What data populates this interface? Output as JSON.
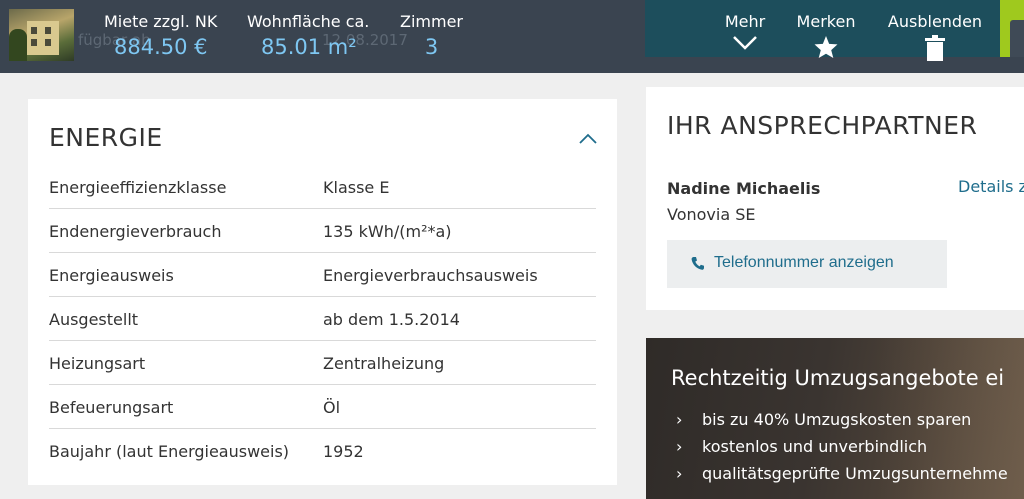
{
  "topbar": {
    "ghost_left": "fügbar ab",
    "ghost_date": "12.08.2017",
    "stats": [
      {
        "label": "Miete zzgl. NK",
        "value": "884.50 €"
      },
      {
        "label": "Wohnfläche ca.",
        "value": "85.01 m²"
      },
      {
        "label": "Zimmer",
        "value": "3"
      }
    ],
    "actions": [
      {
        "label": "Mehr",
        "icon": "chevron-down-icon"
      },
      {
        "label": "Merken",
        "icon": "star-icon"
      },
      {
        "label": "Ausblenden",
        "icon": "trash-icon"
      }
    ]
  },
  "energy": {
    "title": "ENERGIE",
    "rows": [
      {
        "key": "Energieeffizienzklasse",
        "value": "Klasse E"
      },
      {
        "key": "Endenergieverbrauch",
        "value": "135 kWh/(m²*a)"
      },
      {
        "key": "Energieausweis",
        "value": "Energieverbrauchsausweis"
      },
      {
        "key": "Ausgestellt",
        "value": "ab dem 1.5.2014"
      },
      {
        "key": "Heizungsart",
        "value": "Zentralheizung"
      },
      {
        "key": "Befeuerungsart",
        "value": "Öl"
      },
      {
        "key": "Baujahr (laut Energieausweis)",
        "value": "1952"
      }
    ]
  },
  "contact": {
    "title": "IHR ANSPRECHPARTNER",
    "name": "Nadine Michaelis",
    "company": "Vonovia SE",
    "details_link": "Details z",
    "phone_button": "Telefonnummer anzeigen"
  },
  "promo": {
    "title": "Rechtzeitig Umzugsangebote ei",
    "items": [
      "bis zu 40% Umzugskosten sparen",
      "kostenlos und unverbindlich",
      "qualitätsgeprüfte Umzugsunternehme"
    ]
  },
  "colors": {
    "topbar_bg": "#3a4450",
    "action_bg": "#1d4e5c",
    "accent_blue": "#7ec7f2",
    "link_blue": "#1f6d8c",
    "green": "#9fc91e"
  }
}
